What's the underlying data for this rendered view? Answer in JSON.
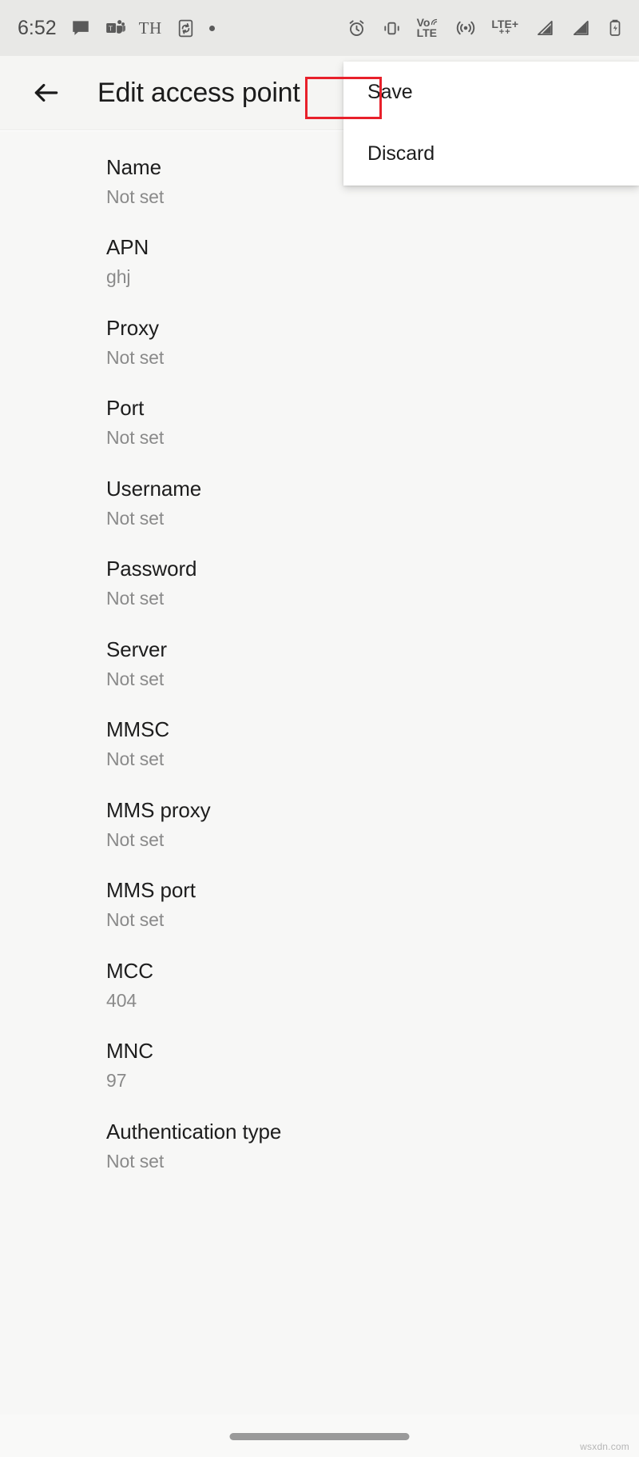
{
  "status_bar": {
    "time": "6:52",
    "left_icons": [
      {
        "name": "messages-icon",
        "glyph": "messages"
      },
      {
        "name": "teams-icon",
        "glyph": "teams"
      },
      {
        "name": "th-text-icon",
        "glyph": "TH"
      },
      {
        "name": "phone-sync-icon",
        "glyph": "phone-sync"
      },
      {
        "name": "dot-indicator-icon",
        "glyph": "dot"
      }
    ],
    "right_icons": [
      {
        "name": "alarm-icon",
        "glyph": "alarm"
      },
      {
        "name": "vibrate-icon",
        "glyph": "vibrate"
      },
      {
        "name": "volte-icon",
        "glyph": "VoLTE",
        "line1": "Vo",
        "line2": "LTE"
      },
      {
        "name": "hotspot-icon",
        "glyph": "hotspot"
      },
      {
        "name": "lte-plus-icon",
        "glyph": "LTE+",
        "line1": "LTE+",
        "line2": "++"
      },
      {
        "name": "signal-sim1-icon",
        "glyph": "signal"
      },
      {
        "name": "signal-sim2-icon",
        "glyph": "signal"
      },
      {
        "name": "battery-charging-icon",
        "glyph": "battery"
      }
    ]
  },
  "app_bar": {
    "back_label": "back-arrow",
    "title": "Edit access point"
  },
  "menu": {
    "items": [
      {
        "label": "Save",
        "highlighted": true
      },
      {
        "label": "Discard",
        "highlighted": false
      }
    ],
    "highlight_color": "#e8202a"
  },
  "settings": {
    "rows": [
      {
        "title": "Name",
        "value": "Not set"
      },
      {
        "title": "APN",
        "value": "ghj"
      },
      {
        "title": "Proxy",
        "value": "Not set"
      },
      {
        "title": "Port",
        "value": "Not set"
      },
      {
        "title": "Username",
        "value": "Not set"
      },
      {
        "title": "Password",
        "value": "Not set"
      },
      {
        "title": "Server",
        "value": "Not set"
      },
      {
        "title": "MMSC",
        "value": "Not set"
      },
      {
        "title": "MMS proxy",
        "value": "Not set"
      },
      {
        "title": "MMS port",
        "value": "Not set"
      },
      {
        "title": "MCC",
        "value": "404"
      },
      {
        "title": "MNC",
        "value": "97"
      },
      {
        "title": "Authentication type",
        "value": "Not set"
      }
    ]
  },
  "nav_bar": {
    "gesture_handle": "home-gesture-pill"
  },
  "watermark": {
    "text": "wsxdn.com"
  }
}
